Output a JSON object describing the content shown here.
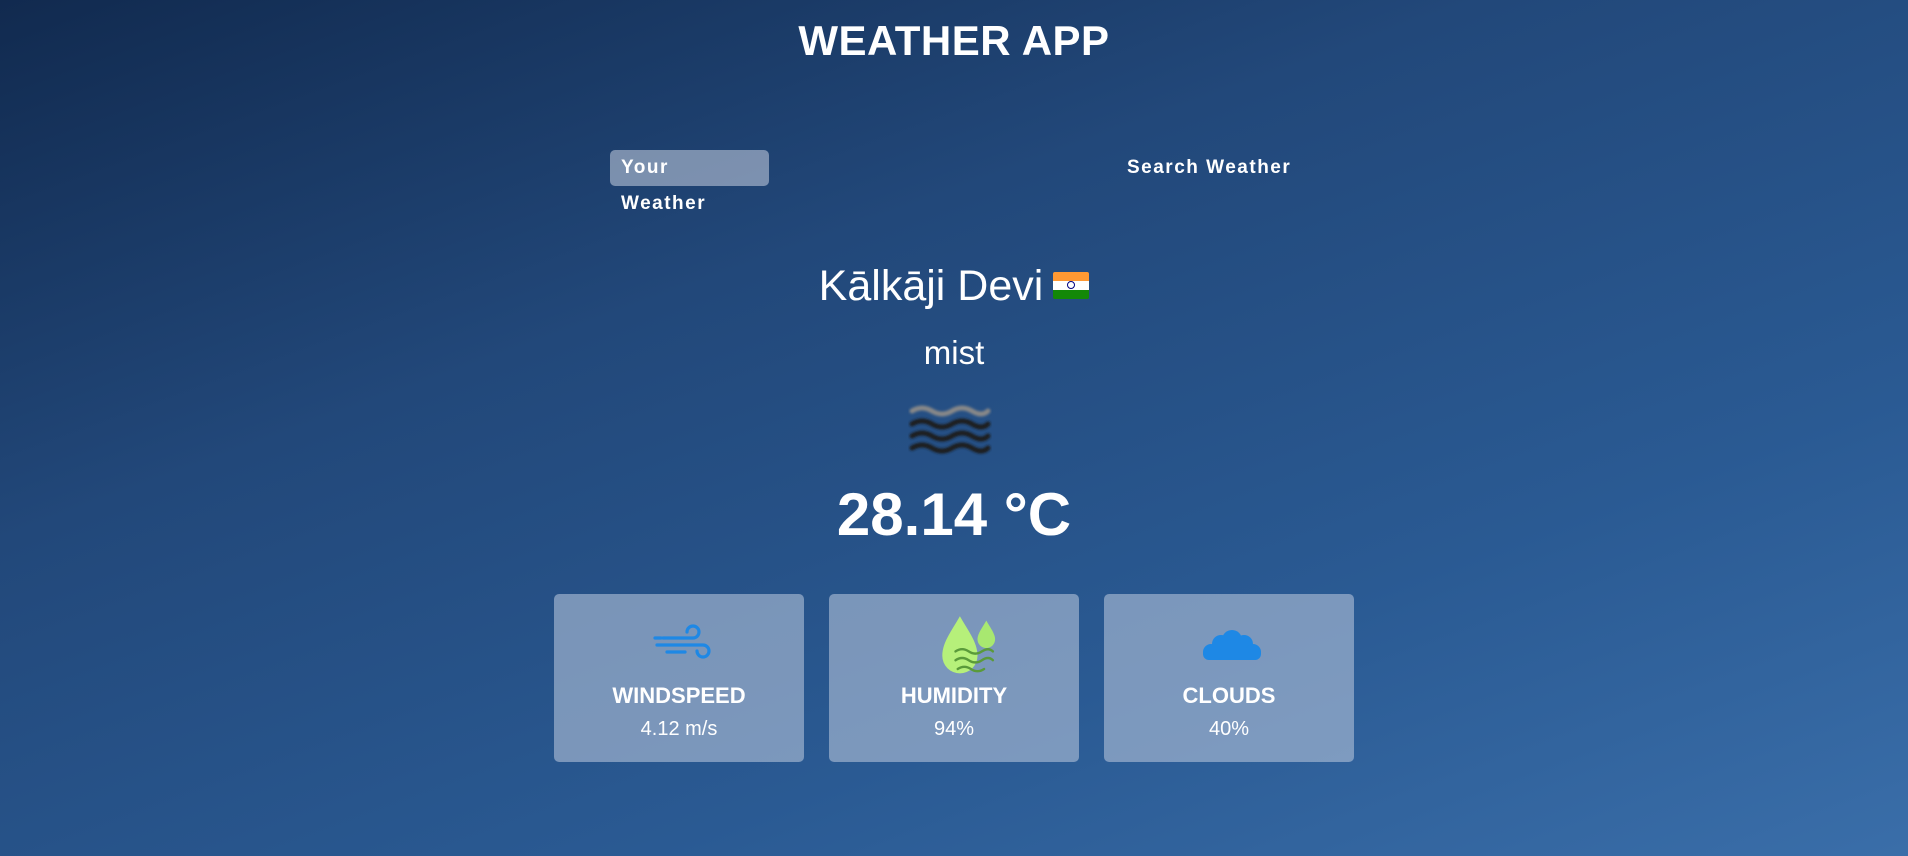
{
  "app": {
    "title": "WEATHER APP"
  },
  "tabs": [
    {
      "label": "Your Weather",
      "active": true
    },
    {
      "label": "Search Weather",
      "active": false
    }
  ],
  "weather": {
    "city": "Kālkāji Devi",
    "country_flag_icon": "india-flag-icon",
    "description": "mist",
    "condition_icon": "mist-icon",
    "temperature": "28.14 °C"
  },
  "stats": [
    {
      "label": "WINDSPEED",
      "value": "4.12 m/s",
      "icon": "wind-icon"
    },
    {
      "label": "HUMIDITY",
      "value": "94%",
      "icon": "humidity-icon"
    },
    {
      "label": "CLOUDS",
      "value": "40%",
      "icon": "cloud-icon"
    }
  ],
  "colors": {
    "background_top": "#112a4f",
    "background_bottom": "#3a6ea9",
    "card_bg": "#afbed7",
    "wind_icon": "#1e88e5",
    "humidity_icon": "#b6f07a",
    "cloud_icon": "#1e88e5"
  }
}
